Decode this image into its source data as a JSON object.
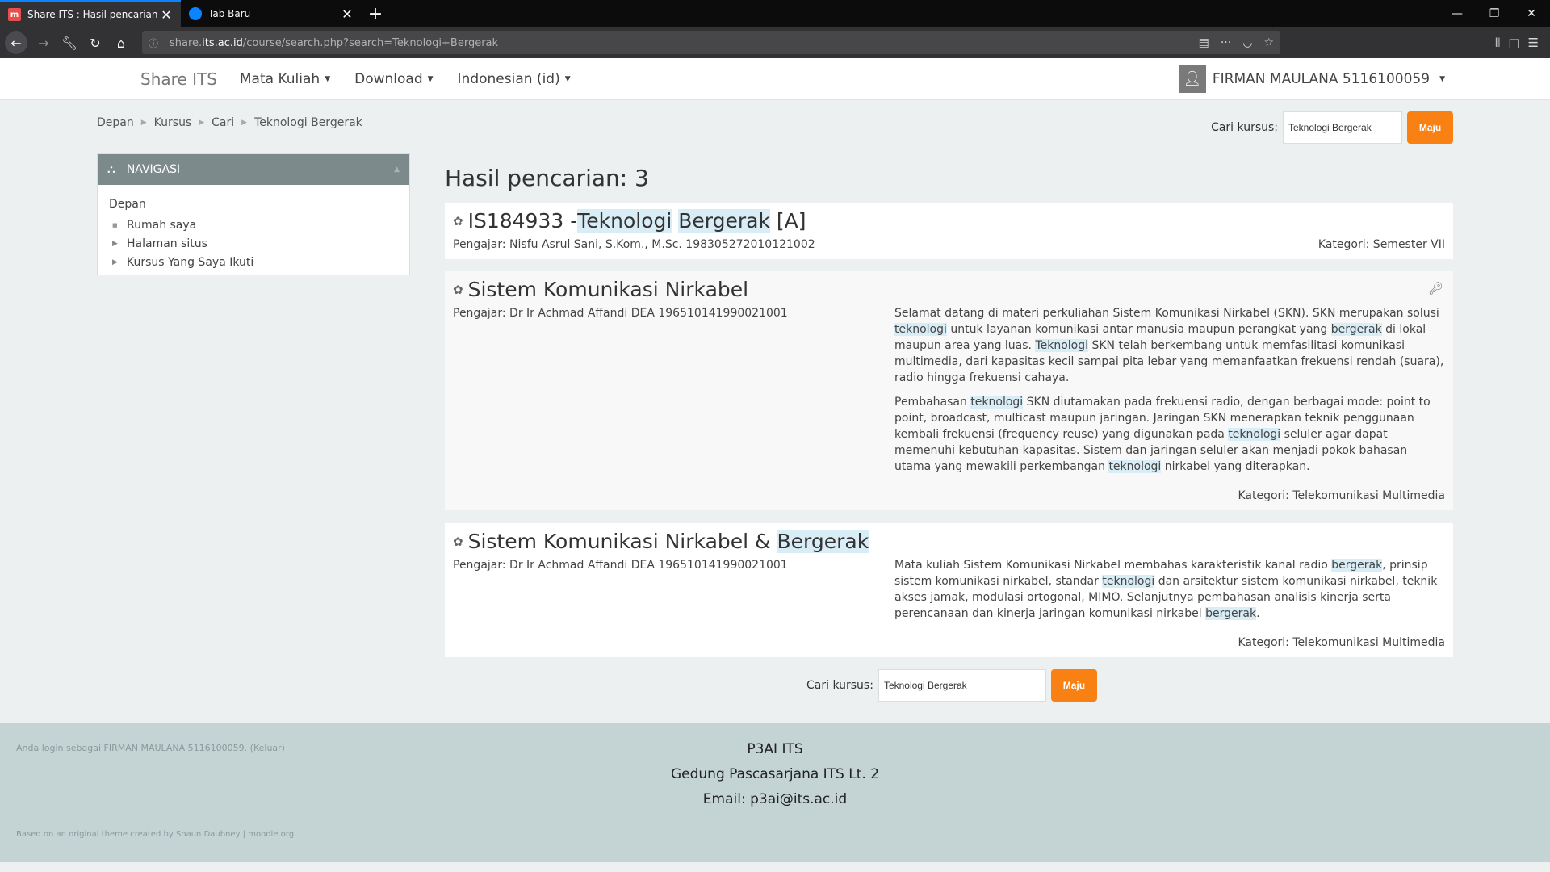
{
  "browser": {
    "tabs": [
      {
        "title": "Share ITS : Hasil pencarian",
        "active": true,
        "favicon": "moodle-icon"
      },
      {
        "title": "Tab Baru",
        "active": false,
        "favicon": "firefox-icon"
      }
    ],
    "url_prefix": "share.",
    "url_domain": "its.ac.id",
    "url_path": "/course/search.php?search=Teknologi+Bergerak"
  },
  "header": {
    "brand": "Share ITS",
    "menu": [
      "Mata Kuliah",
      "Download",
      "Indonesian (id)"
    ],
    "user": "FIRMAN MAULANA 5116100059"
  },
  "breadcrumb": [
    "Depan",
    "Kursus",
    "Cari",
    "Teknologi Bergerak"
  ],
  "search": {
    "label": "Cari kursus:",
    "value": "Teknologi Bergerak",
    "button": "Maju"
  },
  "navigation": {
    "title": "NAVIGASI",
    "root": "Depan",
    "items": [
      {
        "label": "Rumah saya",
        "type": "leaf"
      },
      {
        "label": "Halaman situs",
        "type": "branch"
      },
      {
        "label": "Kursus Yang Saya Ikuti",
        "type": "branch"
      }
    ]
  },
  "results": {
    "title": "Hasil pencarian: 3",
    "courses": [
      {
        "name_parts": [
          "IS184933 - ",
          "Teknologi",
          " ",
          "Bergerak",
          " [A]"
        ],
        "teacher": "Pengajar: Nisfu Asrul Sani, S.Kom., M.Sc. 198305272010121002",
        "category": "Kategori: Semester VII"
      },
      {
        "name": "Sistem Komunikasi Nirkabel",
        "teacher": "Pengajar: Dr Ir Achmad Affandi DEA 196510141990021001",
        "category": "Kategori: Telekomunikasi Multimedia",
        "summary_p1": [
          "Selamat datang di materi perkuliahan Sistem Komunikasi Nirkabel (SKN). SKN merupakan solusi ",
          "teknologi",
          " untuk layanan komunikasi antar manusia maupun perangkat yang ",
          "bergerak",
          " di lokal maupun area yang luas. ",
          "Teknologi",
          " SKN telah berkembang untuk memfasilitasi komunikasi multimedia, dari kapasitas kecil sampai pita lebar yang memanfaatkan frekuensi rendah (suara), radio hingga frekuensi cahaya."
        ],
        "summary_p2": [
          "Pembahasan ",
          "teknologi",
          " SKN diutamakan pada frekuensi radio, dengan berbagai mode: point to point, broadcast, multicast maupun jaringan. Jaringan SKN menerapkan teknik penggunaan kembali frekuensi (frequency reuse) yang digunakan pada ",
          "teknologi",
          " seluler agar dapat memenuhi kebutuhan kapasitas. Sistem dan jaringan seluler akan menjadi pokok bahasan utama yang mewakili perkembangan ",
          "teknologi",
          " nirkabel yang diterapkan."
        ]
      },
      {
        "name_parts": [
          "Sistem Komunikasi Nirkabel & ",
          "Bergerak"
        ],
        "teacher": "Pengajar: Dr Ir Achmad Affandi DEA 196510141990021001",
        "category": "Kategori: Telekomunikasi Multimedia",
        "summary_p1": [
          "Mata kuliah Sistem Komunikasi Nirkabel membahas karakteristik kanal radio ",
          "bergerak",
          ", prinsip sistem komunikasi nirkabel, standar ",
          "teknologi",
          " dan arsitektur sistem komunikasi nirkabel, teknik akses jamak, modulasi ortogonal, MIMO. Selanjutnya pembahasan analisis kinerja serta perencanaan dan kinerja jaringan komunikasi nirkabel ",
          "bergerak",
          "."
        ]
      }
    ]
  },
  "footer": {
    "login_info": "Anda login sebagai FIRMAN MAULANA 5116100059. (Keluar)",
    "org": "P3AI ITS",
    "address": "Gedung Pascasarjana ITS Lt. 2",
    "email": "Email: p3ai@its.ac.id",
    "credit": "Based on an original theme created by Shaun Daubney | moodle.org"
  },
  "colors": {
    "accent": "#f98012",
    "nav_header": "#7d8a8b",
    "highlight": "#d9edf7",
    "footer": "#c4d4d5"
  }
}
